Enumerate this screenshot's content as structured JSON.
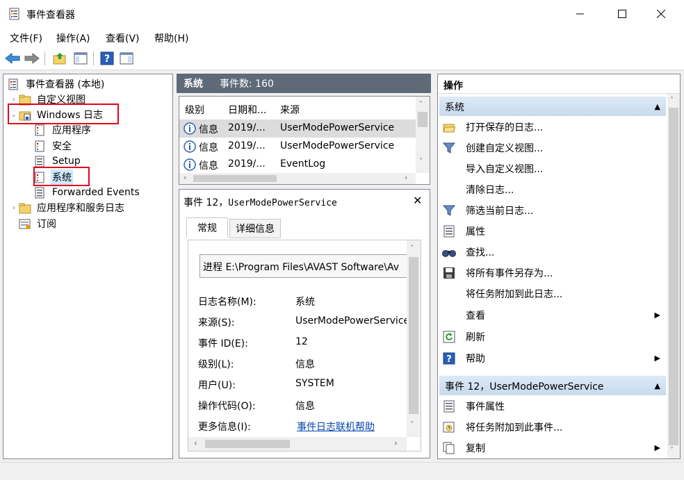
{
  "window": {
    "title": "事件查看器"
  },
  "menu": [
    "文件(F)",
    "操作(A)",
    "查看(V)",
    "帮助(H)"
  ],
  "tree": {
    "root": "事件查看器 (本地)",
    "custom_views": "自定义视图",
    "windows_logs": "Windows 日志",
    "application": "应用程序",
    "security": "安全",
    "setup": "Setup",
    "system": "系统",
    "forwarded": "Forwarded Events",
    "app_service_logs": "应用程序和服务日志",
    "subscriptions": "订阅"
  },
  "middle": {
    "log_name": "系统",
    "event_count": "事件数: 160",
    "columns": [
      "级别",
      "日期和...",
      "来源"
    ],
    "rows": [
      {
        "level": "信息",
        "date": "2019/...",
        "source": "UserModePowerService"
      },
      {
        "level": "信息",
        "date": "2019/...",
        "source": "UserModePowerService"
      },
      {
        "level": "信息",
        "date": "2019/...",
        "source": "EventLog"
      }
    ]
  },
  "detail": {
    "title_prefix": "事件 12，",
    "title_source": "UserModePowerService",
    "tab_general": "常规",
    "tab_details": "详细信息",
    "process_text": "进程 E:\\Program Files\\AVAST Software\\Av",
    "fields": [
      {
        "label": "日志名称(M):",
        "value": "系统"
      },
      {
        "label": "来源(S):",
        "value": "UserModePowerService"
      },
      {
        "label": "事件 ID(E):",
        "value": "12"
      },
      {
        "label": "级别(L):",
        "value": "信息"
      },
      {
        "label": "用户(U):",
        "value": "SYSTEM"
      },
      {
        "label": "操作代码(O):",
        "value": "信息"
      },
      {
        "label": "更多信息(I):",
        "value": "事件日志联机帮助"
      }
    ]
  },
  "actions": {
    "title": "操作",
    "section1": "系统",
    "items1": [
      {
        "label": "打开保存的日志...",
        "icon": "folder-open-icon"
      },
      {
        "label": "创建自定义视图...",
        "icon": "filter-icon"
      },
      {
        "label": "导入自定义视图...",
        "icon": ""
      },
      {
        "label": "清除日志...",
        "icon": ""
      },
      {
        "label": "筛选当前日志...",
        "icon": "filter-icon"
      },
      {
        "label": "属性",
        "icon": "properties-icon"
      },
      {
        "label": "查找...",
        "icon": "binoculars-icon"
      },
      {
        "label": "将所有事件另存为...",
        "icon": "save-icon"
      },
      {
        "label": "将任务附加到此日志...",
        "icon": ""
      },
      {
        "label": "查看",
        "icon": ""
      },
      {
        "label": "刷新",
        "icon": "refresh-icon"
      },
      {
        "label": "帮助",
        "icon": "help-icon"
      }
    ],
    "section2": "事件 12，UserModePowerService",
    "items2": [
      {
        "label": "事件属性",
        "icon": "properties-icon"
      },
      {
        "label": "将任务附加到此事件...",
        "icon": "task-icon"
      },
      {
        "label": "复制",
        "icon": "copy-icon"
      }
    ]
  },
  "colors": {
    "highlight": "#e3001b",
    "selection": "#cce8ff",
    "header": "#5e6a78"
  }
}
